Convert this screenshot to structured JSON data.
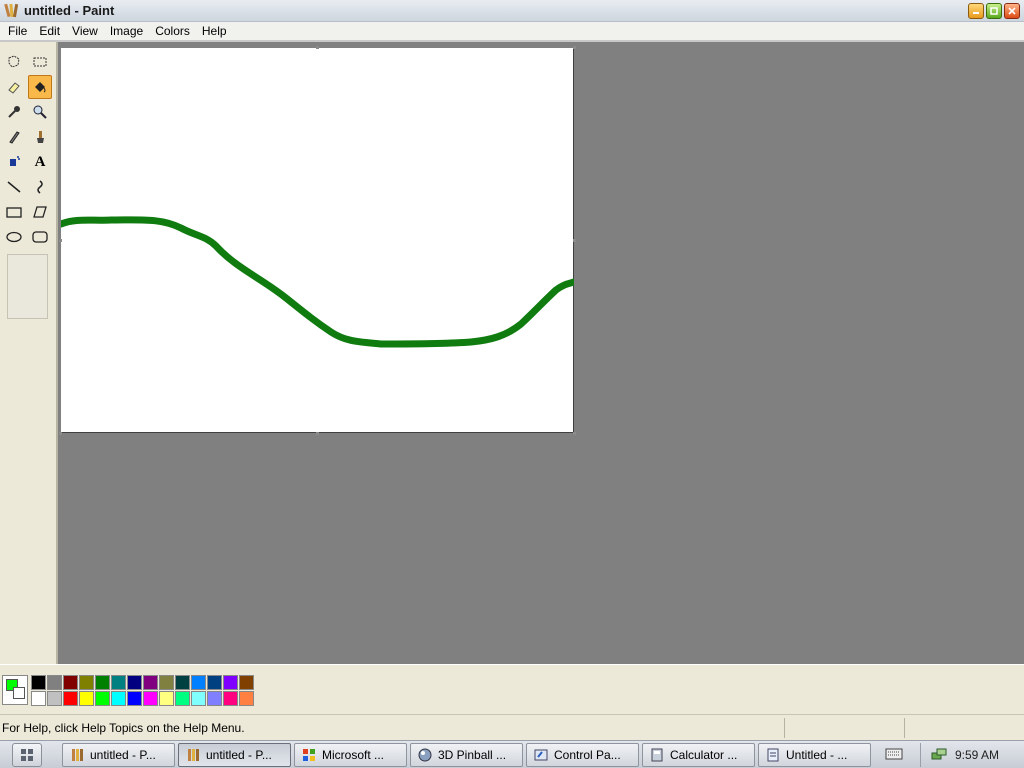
{
  "window": {
    "title": "untitled - Paint"
  },
  "menu": [
    "File",
    "Edit",
    "View",
    "Image",
    "Colors",
    "Help"
  ],
  "tools": [
    {
      "name": "free-form-select-icon",
      "active": false
    },
    {
      "name": "rect-select-icon",
      "active": false
    },
    {
      "name": "eraser-icon",
      "active": false
    },
    {
      "name": "fill-bucket-icon",
      "active": true
    },
    {
      "name": "color-picker-icon",
      "active": false
    },
    {
      "name": "magnifier-icon",
      "active": false
    },
    {
      "name": "pencil-icon",
      "active": false
    },
    {
      "name": "brush-icon",
      "active": false
    },
    {
      "name": "airbrush-icon",
      "active": false
    },
    {
      "name": "text-icon",
      "active": false
    },
    {
      "name": "line-icon",
      "active": false
    },
    {
      "name": "curve-icon",
      "active": false
    },
    {
      "name": "rectangle-icon",
      "active": false
    },
    {
      "name": "polygon-icon",
      "active": false
    },
    {
      "name": "ellipse-icon",
      "active": false
    },
    {
      "name": "rounded-rect-icon",
      "active": false
    }
  ],
  "text_tool_glyph": "A",
  "colors": {
    "foreground": "#00ff00",
    "background": "#ffffff",
    "stroke": "#107c10",
    "palette_row1": [
      "#000000",
      "#808080",
      "#800000",
      "#808000",
      "#008000",
      "#008080",
      "#000080",
      "#800080",
      "#808040",
      "#004040",
      "#0080ff",
      "#004080",
      "#8000ff",
      "#804000"
    ],
    "palette_row2": [
      "#ffffff",
      "#c0c0c0",
      "#ff0000",
      "#ffff00",
      "#00ff00",
      "#00ffff",
      "#0000ff",
      "#ff00ff",
      "#ffff80",
      "#00ff80",
      "#80ffff",
      "#8080ff",
      "#ff0080",
      "#ff8040"
    ]
  },
  "status": {
    "help_text": "For Help, click Help Topics on the Help Menu."
  },
  "taskbar": {
    "buttons": [
      {
        "label": "untitled - P...",
        "icon": "paint-icon",
        "active": false
      },
      {
        "label": "untitled - P...",
        "icon": "paint-icon",
        "active": true
      },
      {
        "label": "Microsoft ...",
        "icon": "microsoft-icon",
        "active": false
      },
      {
        "label": "3D Pinball ...",
        "icon": "pinball-icon",
        "active": false
      },
      {
        "label": "Control Pa...",
        "icon": "control-panel-icon",
        "active": false
      },
      {
        "label": "Calculator ...",
        "icon": "calculator-icon",
        "active": false
      },
      {
        "label": "Untitled - ...",
        "icon": "notepad-icon",
        "active": false
      }
    ],
    "clock": "9:59 AM"
  }
}
